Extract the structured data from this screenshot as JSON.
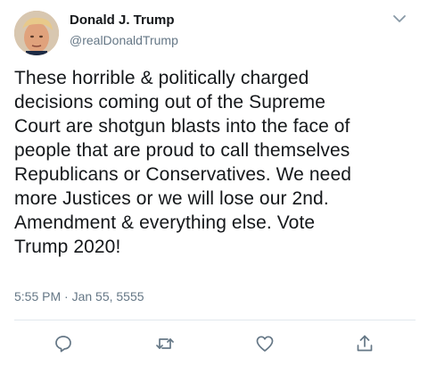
{
  "tweet": {
    "author": {
      "display_name": "Donald J. Trump",
      "handle": "@realDonaldTrump"
    },
    "text_lines": [
      "These horrible & politically charged",
      "decisions coming out of the Supreme",
      "Court are shotgun blasts into the face of",
      "people that are proud to call themselves",
      "Republicans or Conservatives. We need",
      "more Justices or we will lose our 2nd.",
      "Amendment & everything else. Vote",
      "Trump 2020!"
    ],
    "timestamp": "5:55 PM · Jan 55, 5555"
  },
  "icons": {
    "menu": "chevron-down-icon",
    "reply": "reply-icon",
    "retweet": "retweet-icon",
    "like": "heart-icon",
    "share": "share-icon"
  },
  "colors": {
    "text_primary": "#14171a",
    "text_secondary": "#657786",
    "icon": "#657786",
    "divider": "#e1e8ed"
  }
}
